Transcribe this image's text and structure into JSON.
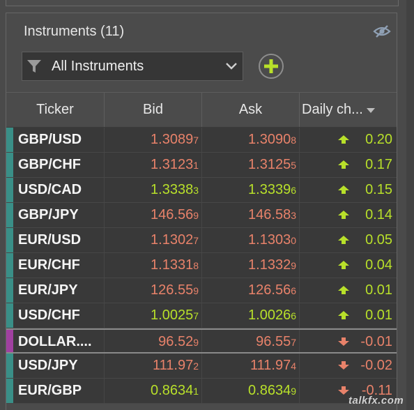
{
  "panel": {
    "title": "Instruments (11)",
    "filter_label": "All Instruments"
  },
  "columns": [
    "Ticker",
    "Bid",
    "Ask",
    "Daily ch..."
  ],
  "colors": {
    "up_text": "#b8e02a",
    "down_text": "#e8826a",
    "mark_teal": "#3a8f87",
    "mark_purple": "#a040a0"
  },
  "rows": [
    {
      "ticker": "GBP/USD",
      "bid": "1.3089",
      "bid_pip": "7",
      "bid_dir": "down",
      "ask": "1.3090",
      "ask_pip": "8",
      "ask_dir": "down",
      "change": "0.20",
      "trend": "up",
      "mark": "teal"
    },
    {
      "ticker": "GBP/CHF",
      "bid": "1.3123",
      "bid_pip": "1",
      "bid_dir": "down",
      "ask": "1.3125",
      "ask_pip": "5",
      "ask_dir": "down",
      "change": "0.17",
      "trend": "up",
      "mark": "teal"
    },
    {
      "ticker": "USD/CAD",
      "bid": "1.3338",
      "bid_pip": "3",
      "bid_dir": "up",
      "ask": "1.3339",
      "ask_pip": "6",
      "ask_dir": "up",
      "change": "0.15",
      "trend": "up",
      "mark": "teal"
    },
    {
      "ticker": "GBP/JPY",
      "bid": "146.56",
      "bid_pip": "9",
      "bid_dir": "down",
      "ask": "146.58",
      "ask_pip": "3",
      "ask_dir": "down",
      "change": "0.14",
      "trend": "up",
      "mark": "teal"
    },
    {
      "ticker": "EUR/USD",
      "bid": "1.1302",
      "bid_pip": "7",
      "bid_dir": "down",
      "ask": "1.1303",
      "ask_pip": "0",
      "ask_dir": "down",
      "change": "0.05",
      "trend": "up",
      "mark": "teal"
    },
    {
      "ticker": "EUR/CHF",
      "bid": "1.1331",
      "bid_pip": "8",
      "bid_dir": "down",
      "ask": "1.1332",
      "ask_pip": "9",
      "ask_dir": "down",
      "change": "0.04",
      "trend": "up",
      "mark": "teal"
    },
    {
      "ticker": "EUR/JPY",
      "bid": "126.55",
      "bid_pip": "9",
      "bid_dir": "down",
      "ask": "126.56",
      "ask_pip": "6",
      "ask_dir": "down",
      "change": "0.01",
      "trend": "up",
      "mark": "teal"
    },
    {
      "ticker": "USD/CHF",
      "bid": "1.0025",
      "bid_pip": "7",
      "bid_dir": "up",
      "ask": "1.0026",
      "ask_pip": "6",
      "ask_dir": "up",
      "change": "0.01",
      "trend": "up",
      "mark": "teal"
    },
    {
      "ticker": "DOLLAR....",
      "bid": "96.52",
      "bid_pip": "9",
      "bid_dir": "down",
      "ask": "96.55",
      "ask_pip": "7",
      "ask_dir": "down",
      "change": "-0.01",
      "trend": "down",
      "mark": "purple",
      "boxed": true
    },
    {
      "ticker": "USD/JPY",
      "bid": "111.97",
      "bid_pip": "2",
      "bid_dir": "down",
      "ask": "111.97",
      "ask_pip": "4",
      "ask_dir": "down",
      "change": "-0.02",
      "trend": "down",
      "mark": "teal"
    },
    {
      "ticker": "EUR/GBP",
      "bid": "0.8634",
      "bid_pip": "1",
      "bid_dir": "up",
      "ask": "0.8634",
      "ask_pip": "9",
      "ask_dir": "up",
      "change": "-0.11",
      "trend": "down",
      "mark": "teal"
    }
  ],
  "watermark": "talkfx.com"
}
